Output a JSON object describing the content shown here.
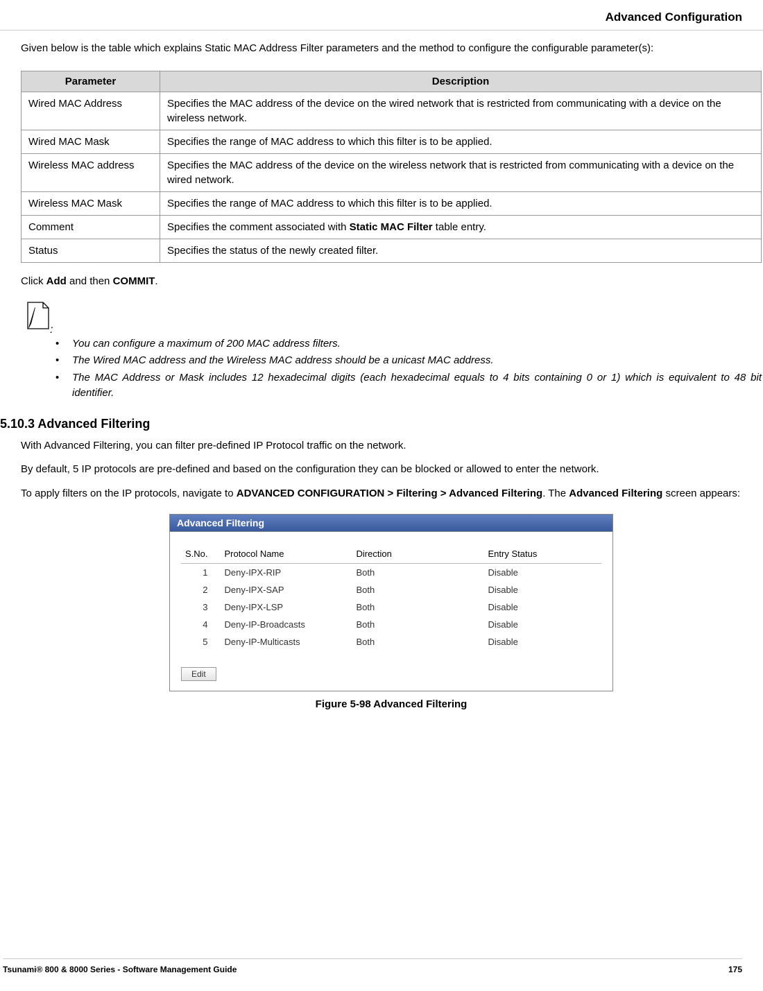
{
  "header": {
    "title": "Advanced Configuration"
  },
  "intro": "Given below is the table which explains Static MAC Address Filter parameters and the method to configure the configurable parameter(s):",
  "table": {
    "headers": {
      "param": "Parameter",
      "desc": "Description"
    },
    "rows": [
      {
        "param": "Wired MAC Address",
        "desc": "Specifies the MAC address of the device on the wired network that is restricted from communicating with a device on the wireless network."
      },
      {
        "param": "Wired MAC Mask",
        "desc": "Specifies the range of MAC address to which this filter is to be applied."
      },
      {
        "param": "Wireless MAC address",
        "desc": "Specifies the MAC address of the device on the wireless network that is restricted from communicating with a device on the wired network."
      },
      {
        "param": "Wireless MAC Mask",
        "desc": "Specifies the range of MAC address to which this filter is to be applied."
      },
      {
        "param": "Comment",
        "desc_pre": "Specifies the comment associated with ",
        "desc_bold": "Static MAC Filter",
        "desc_post": " table entry."
      },
      {
        "param": "Status",
        "desc": "Specifies the status of the newly created filter."
      }
    ]
  },
  "click_line": {
    "pre": "Click ",
    "b1": "Add",
    "mid": " and then ",
    "b2": "COMMIT",
    "post": "."
  },
  "notes": [
    "You can configure a maximum of 200 MAC address filters.",
    "The Wired MAC address and the Wireless MAC address should be a unicast MAC address.",
    "The MAC Address or Mask includes 12 hexadecimal digits (each hexadecimal equals to 4 bits containing 0 or 1) which is equivalent to 48 bit identifier."
  ],
  "section": {
    "number": "5.10.3 Advanced Filtering",
    "p1": "With Advanced Filtering, you can filter pre-defined IP Protocol traffic on the network.",
    "p2": "By default, 5 IP protocols are pre-defined and based on the configuration they can be blocked or allowed to enter the network.",
    "p3_pre": "To apply filters on the IP protocols, navigate to ",
    "p3_b": "ADVANCED CONFIGURATION > Filtering > Advanced Filtering",
    "p3_mid": ". The ",
    "p3_b2": "Advanced Filtering",
    "p3_post": " screen appears:"
  },
  "screenshot": {
    "title": "Advanced Filtering",
    "headers": {
      "sno": "S.No.",
      "proto": "Protocol Name",
      "dir": "Direction",
      "status": "Entry Status"
    },
    "rows": [
      {
        "sno": "1",
        "proto": "Deny-IPX-RIP",
        "dir": "Both",
        "status": "Disable"
      },
      {
        "sno": "2",
        "proto": "Deny-IPX-SAP",
        "dir": "Both",
        "status": "Disable"
      },
      {
        "sno": "3",
        "proto": "Deny-IPX-LSP",
        "dir": "Both",
        "status": "Disable"
      },
      {
        "sno": "4",
        "proto": "Deny-IP-Broadcasts",
        "dir": "Both",
        "status": "Disable"
      },
      {
        "sno": "5",
        "proto": "Deny-IP-Multicasts",
        "dir": "Both",
        "status": "Disable"
      }
    ],
    "button": "Edit"
  },
  "figure_caption": "Figure 5-98 Advanced Filtering",
  "footer": {
    "left": "Tsunami® 800 & 8000 Series - Software Management Guide",
    "page": "175"
  }
}
